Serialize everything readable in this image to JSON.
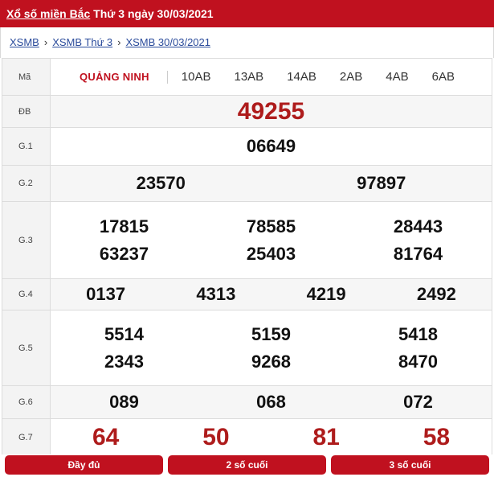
{
  "header": {
    "title_link": "Xổ số miền Bắc",
    "title_rest": "Thứ 3 ngày 30/03/2021",
    "bg_color": "#c0111f"
  },
  "breadcrumb": [
    "XSMB",
    "XSMB Thứ 3",
    "XSMB 30/03/2021"
  ],
  "table": {
    "code_label": "Mã",
    "province": "QUẢNG NINH",
    "codes": [
      "10AB",
      "13AB",
      "14AB",
      "2AB",
      "4AB",
      "6AB"
    ],
    "prizes": {
      "db": {
        "label": "ĐB",
        "numbers": [
          "49255"
        ]
      },
      "g1": {
        "label": "G.1",
        "numbers": [
          "06649"
        ]
      },
      "g2": {
        "label": "G.2",
        "numbers": [
          "23570",
          "97897"
        ]
      },
      "g3": {
        "label": "G.3",
        "numbers": [
          "17815",
          "78585",
          "28443",
          "63237",
          "25403",
          "81764"
        ]
      },
      "g4": {
        "label": "G.4",
        "numbers": [
          "0137",
          "4313",
          "4219",
          "2492"
        ]
      },
      "g5": {
        "label": "G.5",
        "numbers": [
          "5514",
          "5159",
          "5418",
          "2343",
          "9268",
          "8470"
        ]
      },
      "g6": {
        "label": "G.6",
        "numbers": [
          "089",
          "068",
          "072"
        ]
      },
      "g7": {
        "label": "G.7",
        "numbers": [
          "64",
          "50",
          "81",
          "58"
        ]
      }
    }
  },
  "buttons": {
    "full": "Đầy đủ",
    "last2": "2 số cuối",
    "last3": "3 số cuối"
  },
  "colors": {
    "accent": "#c0111f",
    "special_number": "#ae1c1c",
    "link": "#2a4b9b"
  }
}
